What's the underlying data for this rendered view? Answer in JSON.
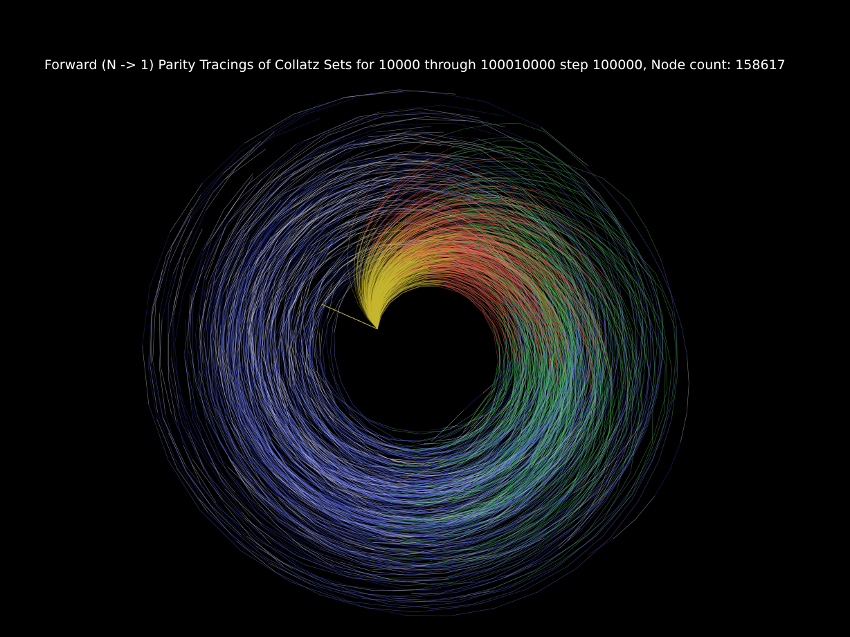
{
  "figure": {
    "title": "Forward (N -> 1) Parity Tracings of Collatz Sets for 10000 through 100010000 step 100000, Node count: 158617",
    "background": "#000000",
    "text_color": "#ffffff"
  },
  "palette": {
    "yellow": "#c8b830",
    "red": "#e8604a",
    "green": "#4ed060",
    "blue": "#6a78f0",
    "white": "#e6e6ff",
    "darkblue": "#3040c0"
  }
}
